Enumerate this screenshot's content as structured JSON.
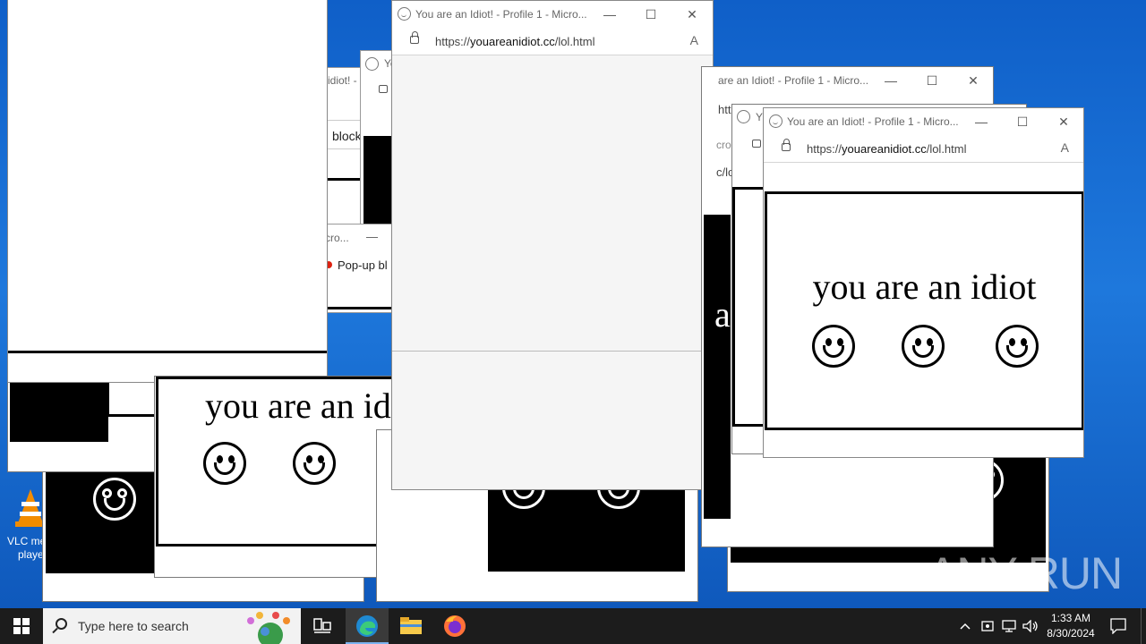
{
  "popup": {
    "title": "You are an Idiot! - Profile 1 - Micro...",
    "title_partial_left": "are an Idiot! - Profile 1 - Micro...",
    "title_fragment": "Yo",
    "title_fragment_short": "Y",
    "url_prefix": "https://",
    "url_domain": "youareanidiot.cc",
    "url_path": "/lol.html",
    "message": "you are an idiot",
    "message_partial": "you are an id",
    "message_fragment": "a",
    "minimize": "—",
    "maximize": "☐",
    "close": "✕",
    "read_aloud": "A"
  },
  "fragments": {
    "idiot_tail": "idiot! - P",
    "block": "block",
    "micro_tail": "cro...",
    "popup_blocked": "Pop-up bl",
    "htt": "htt",
    "cro": "cro",
    "c_lo": "c/lo"
  },
  "desktop": {
    "vlc_label_1": "VLC me",
    "vlc_label_2": "playe"
  },
  "taskbar": {
    "search_placeholder": "Type here to search",
    "time": "1:33 AM",
    "date": "8/30/2024"
  },
  "watermark": "ANY RUN"
}
